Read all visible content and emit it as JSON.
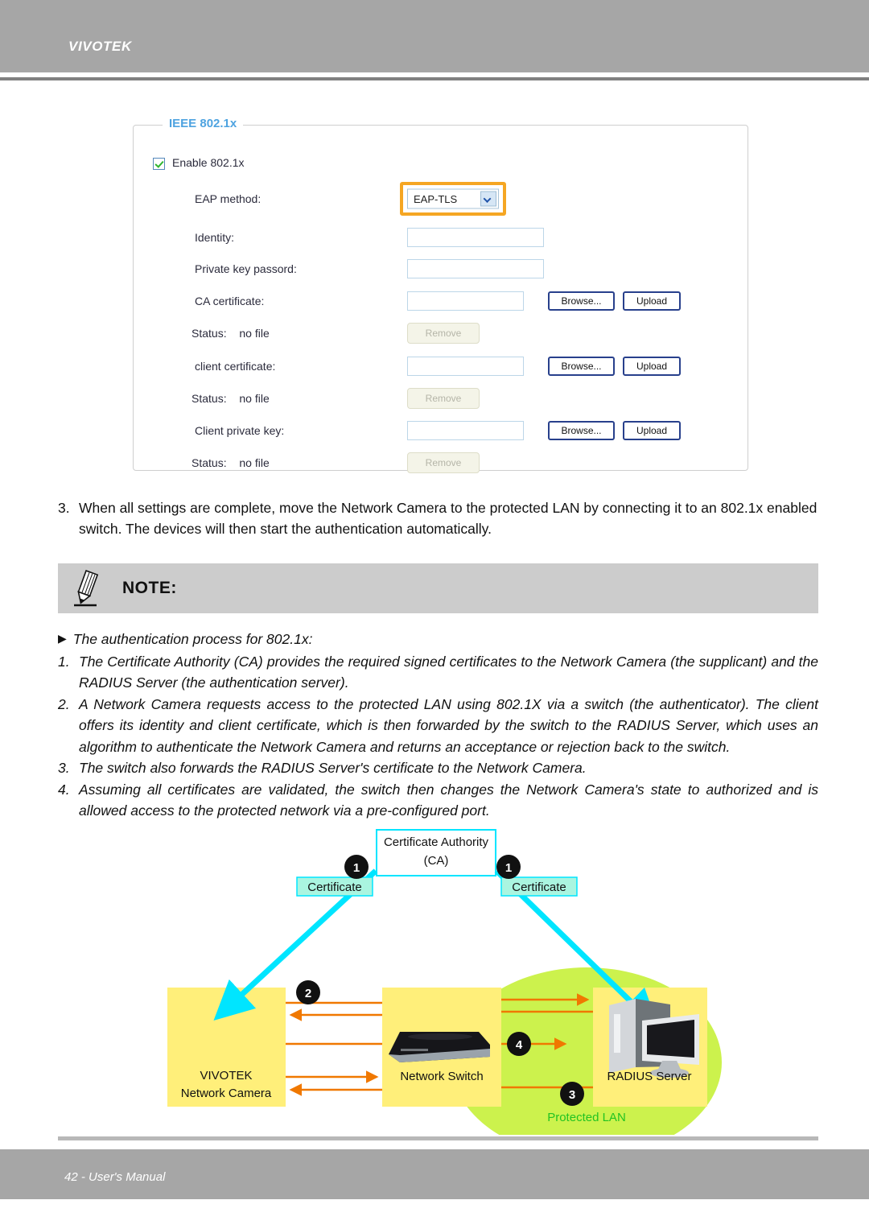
{
  "header": {
    "brand": "VIVOTEK"
  },
  "settings_panel": {
    "legend": "IEEE 802.1x",
    "enable_checkbox_label": "Enable 802.1x",
    "enable_checked": true,
    "rows": [
      {
        "label": "EAP method:",
        "value": "EAP-TLS"
      },
      {
        "label": "Identity:",
        "value": ""
      },
      {
        "label": "Private key passord:",
        "value": ""
      },
      {
        "label": "CA certificate:",
        "value": ""
      },
      {
        "label": "client certificate:",
        "value": ""
      },
      {
        "label": "Client private key:",
        "value": ""
      }
    ],
    "status_label": "Status:",
    "status_value": "no file",
    "browse_label": "Browse...",
    "upload_label": "Upload",
    "remove_label": "Remove",
    "accent_highlight_color": "#f5a623",
    "legend_color": "#4ea3e0",
    "button_border_color": "#28408c"
  },
  "step3": {
    "number": "3.",
    "text": "When all settings are complete, move the Network Camera to the protected LAN by connecting it to an 802.1x enabled switch. The devices will then start the authentication automatically."
  },
  "note": {
    "title": "NOTE:",
    "intro": "The authentication process for 802.1x:",
    "items": [
      {
        "number": "1.",
        "text": "The Certificate Authority (CA) provides the required signed certificates to the Network Camera (the supplicant) and the RADIUS Server (the authentication server)."
      },
      {
        "number": "2.",
        "text": "A Network Camera requests access to the protected LAN using 802.1X via a switch (the authenticator). The client offers its identity and client certificate, which is then forwarded by the switch to the RADIUS Server, which uses an algorithm to authenticate the Network Camera and returns an acceptance or rejection back to the switch."
      },
      {
        "number": "3.",
        "text": "The switch also forwards the RADIUS Server's certificate to the Network Camera."
      },
      {
        "number": "4.",
        "text": "Assuming all certificates are validated, the switch then changes the Network Camera's state to authorized and is allowed access to the protected network via a pre-configured port."
      }
    ]
  },
  "diagram": {
    "ca_box_line1": "Certificate Authority",
    "ca_box_line2": "(CA)",
    "cert_left_label": "Certificate",
    "cert_right_label": "Certificate",
    "badge_1_left": "1",
    "badge_1_right": "1",
    "badge_2": "2",
    "badge_3": "3",
    "badge_4": "4",
    "camera_line1": "VIVOTEK",
    "camera_line2": "Network Camera",
    "switch_label": "Network Switch",
    "server_label": "RADIUS Server",
    "protected_lan_label": "Protected LAN",
    "colors": {
      "cyan_arrow": "#00e5ff",
      "orange_arrow": "#f07800",
      "device_box": "#ffef7a",
      "lan_ellipse": "#ccf24d",
      "cert_box": "#aaf5e0",
      "badge": "#111111",
      "lan_text": "#22c322"
    }
  },
  "footer": {
    "text": "42 - User's Manual"
  }
}
